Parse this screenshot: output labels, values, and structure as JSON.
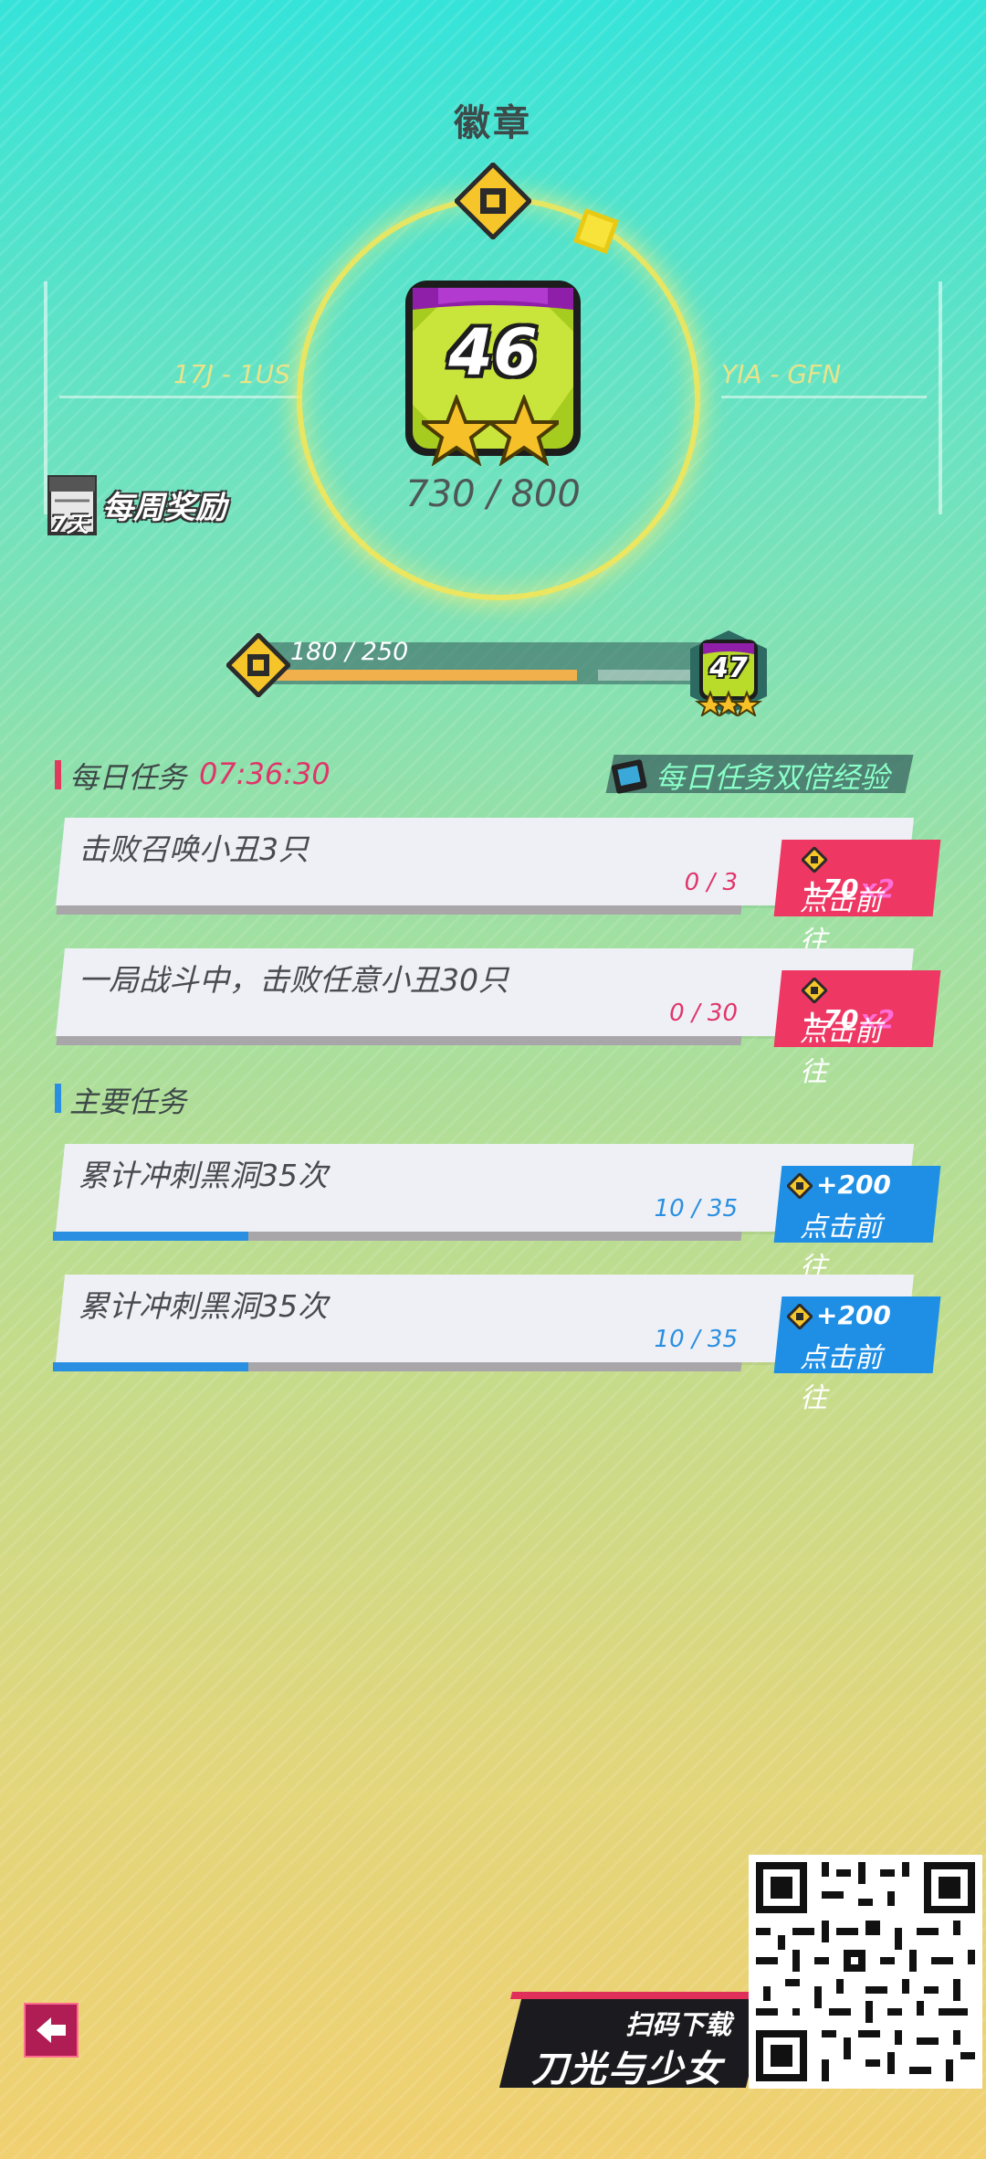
{
  "header": {
    "title": "徽章"
  },
  "badge": {
    "level": "46",
    "stars": 2,
    "score_text": "730 / 800",
    "left_code": "17J - 1US",
    "right_code": "YIA - GFN"
  },
  "weekly": {
    "label": "每周奖励",
    "day_badge": "7天"
  },
  "progress": {
    "text": "180 / 250",
    "fraction": 0.72,
    "next_level": "47",
    "next_stars": 3
  },
  "daily": {
    "title": "每日任务",
    "timer": "07:36:30",
    "double_label": "每日任务双倍经验",
    "tasks": [
      {
        "text": "击败召唤小丑3只",
        "progress": "0 / 3",
        "reward": "+70",
        "multiplier": "x2",
        "button": "点击前往"
      },
      {
        "text": "一局战斗中，击败任意小丑30只",
        "progress": "0 / 30",
        "reward": "+70",
        "multiplier": "x2",
        "button": "点击前往"
      }
    ]
  },
  "main": {
    "title": "主要任务",
    "tasks": [
      {
        "text": "累计冲刺黑洞35次",
        "progress": "10 / 35",
        "fraction": 0.2857,
        "reward": "+200",
        "button": "点击前往"
      },
      {
        "text": "累计冲刺黑洞35次",
        "progress": "10 / 35",
        "fraction": 0.2857,
        "reward": "+200",
        "button": "点击前往"
      }
    ]
  },
  "download": {
    "label": "扫码下载",
    "game_name": "刀光与少女"
  },
  "colors": {
    "daily_accent": "#e03a5f",
    "main_accent": "#2a8fe0",
    "progress_fill": "#f2b04c"
  },
  "icons": {
    "back": "back-arrow-icon",
    "coin": "coin-icon",
    "weekly": "calendar-icon",
    "double": "book-icon"
  }
}
